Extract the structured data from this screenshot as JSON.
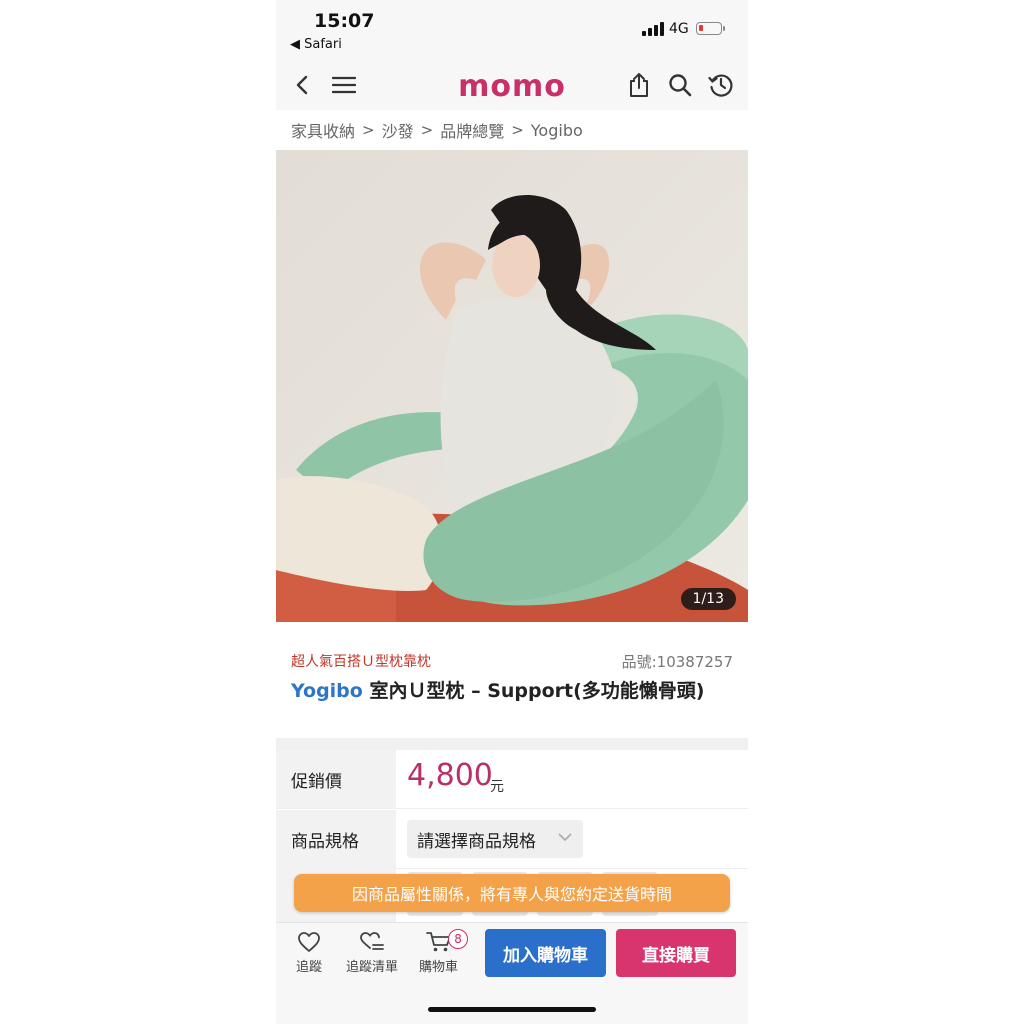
{
  "status": {
    "time": "15:07",
    "back_app": "◀ Safari",
    "network": "4G"
  },
  "nav": {
    "logo_text": "momo"
  },
  "breadcrumb": [
    "家具收納",
    "沙發",
    "品牌總覽",
    "Yogibo"
  ],
  "gallery": {
    "counter": "1/13"
  },
  "product": {
    "tagline": "超人氣百搭Ｕ型枕靠枕",
    "sku": "品號:10387257",
    "brand": "Yogibo",
    "name": " 室內Ｕ型枕 – Support(多功能懶骨頭)"
  },
  "price_row": {
    "label": "促銷價",
    "price": "4,800",
    "unit": "元"
  },
  "spec_row": {
    "label": "商品規格",
    "select_value": "請選擇商品規格"
  },
  "notice": "因商品屬性關係，將有專人與您約定送貨時間",
  "bottom": {
    "follow": "追蹤",
    "wishlist": "追蹤清單",
    "cart": "購物車",
    "cart_count": "8",
    "add_to_cart": "加入購物車",
    "buy_now": "直接購買"
  },
  "colors": {
    "brand_pink": "#c8306a",
    "add_cart_blue": "#2a6fc9",
    "buy_now_pink": "#d8346e",
    "notice_orange": "#f4a24a",
    "price_color": "#b8306a"
  }
}
